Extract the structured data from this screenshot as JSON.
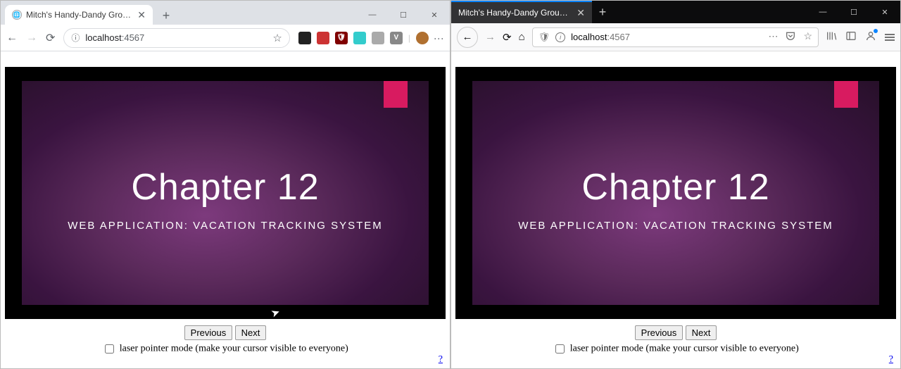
{
  "chrome": {
    "tab_title": "Mitch's Handy-Dandy Group Pow",
    "url_host": "localhost",
    "url_port": ":4567",
    "ext_icons": [
      "ext-dark",
      "ext-red-bar",
      "ext-shield",
      "ext-teal",
      "ext-gray",
      "ext-v",
      "ext-avatar"
    ],
    "win_controls": {
      "min": "—",
      "max": "☐",
      "close": "✕"
    }
  },
  "firefox": {
    "tab_title": "Mitch's Handy-Dandy Group Powe",
    "url_host": "localhost",
    "url_port": ":4567",
    "win_controls": {
      "min": "—",
      "max": "☐",
      "close": "✕"
    }
  },
  "slide": {
    "title": "Chapter 12",
    "subtitle": "WEB APPLICATION: VACATION TRACKING SYSTEM"
  },
  "controls": {
    "prev": "Previous",
    "next": "Next",
    "laser_label": "laser pointer mode (make your cursor visible to everyone)",
    "help": "?"
  }
}
